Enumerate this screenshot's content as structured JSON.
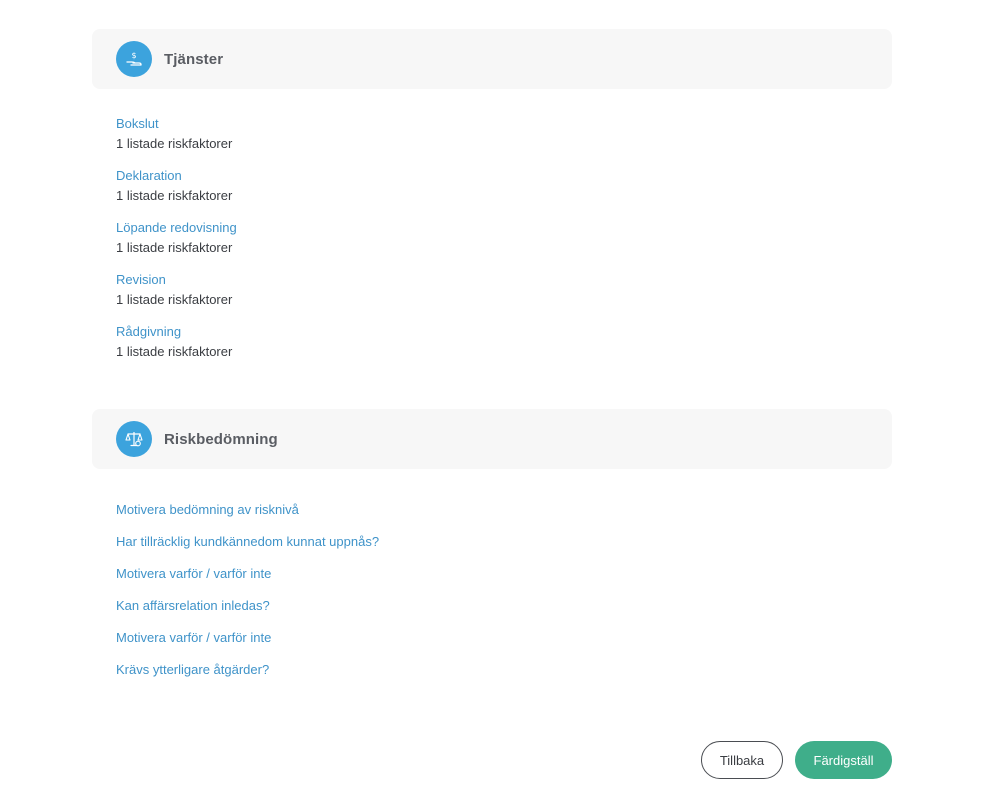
{
  "services_section": {
    "title": "Tjänster",
    "icon": "hand-coin-icon",
    "items": [
      {
        "name": "Bokslut",
        "risk": "1 listade riskfaktorer"
      },
      {
        "name": "Deklaration",
        "risk": "1 listade riskfaktorer"
      },
      {
        "name": "Löpande redovisning",
        "risk": "1 listade riskfaktorer"
      },
      {
        "name": "Revision",
        "risk": "1 listade riskfaktorer"
      },
      {
        "name": "Rådgivning",
        "risk": "1 listade riskfaktorer"
      }
    ]
  },
  "risk_section": {
    "title": "Riskbedömning",
    "icon": "scales-icon",
    "items": [
      "Motivera bedömning av risknivå",
      "Har tillräcklig kundkännedom kunnat uppnås?",
      "Motivera varför / varför inte",
      "Kan affärsrelation inledas?",
      "Motivera varför / varför inte",
      "Krävs ytterligare åtgärder?"
    ]
  },
  "buttons": {
    "back_label": "Tillbaka",
    "finish_label": "Färdigställ"
  },
  "colors": {
    "accent": "#3ca3dd",
    "link": "#3f93c9",
    "primary_button": "#3fae8a",
    "header_bg": "#f7f7f7"
  }
}
